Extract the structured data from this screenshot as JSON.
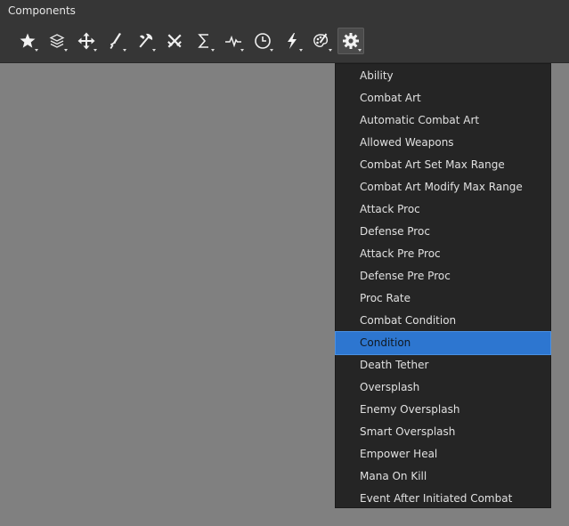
{
  "panel": {
    "title": "Components"
  },
  "toolbar": {
    "tools": [
      {
        "icon": "star-icon",
        "has_dropdown": true
      },
      {
        "icon": "layers-icon",
        "has_dropdown": true
      },
      {
        "icon": "move-arrows-icon",
        "has_dropdown": true
      },
      {
        "icon": "sword-icon",
        "has_dropdown": true
      },
      {
        "icon": "axe-icon",
        "has_dropdown": true
      },
      {
        "icon": "crossed-swords-icon",
        "has_dropdown": false
      },
      {
        "icon": "sigma-icon",
        "has_dropdown": true
      },
      {
        "icon": "pulse-icon",
        "has_dropdown": true
      },
      {
        "icon": "clock-icon",
        "has_dropdown": true
      },
      {
        "icon": "lightning-icon",
        "has_dropdown": true
      },
      {
        "icon": "palette-icon",
        "has_dropdown": true
      },
      {
        "icon": "gear-icon",
        "has_dropdown": true,
        "active": true
      }
    ]
  },
  "menu": {
    "selected_index": 12,
    "items": [
      "Ability",
      "Combat Art",
      "Automatic Combat Art",
      "Allowed Weapons",
      "Combat Art Set Max Range",
      "Combat Art Modify Max Range",
      "Attack Proc",
      "Defense Proc",
      "Attack Pre Proc",
      "Defense Pre Proc",
      "Proc Rate",
      "Combat Condition",
      "Condition",
      "Death Tether",
      "Oversplash",
      "Enemy Oversplash",
      "Smart Oversplash",
      "Empower Heal",
      "Mana On Kill",
      "Event After Initiated Combat"
    ]
  },
  "colors": {
    "panel_bg": "#363636",
    "canvas_bg": "#808080",
    "menu_bg": "#252525",
    "selection": "#2d76d0",
    "text": "#e0e0e0"
  }
}
